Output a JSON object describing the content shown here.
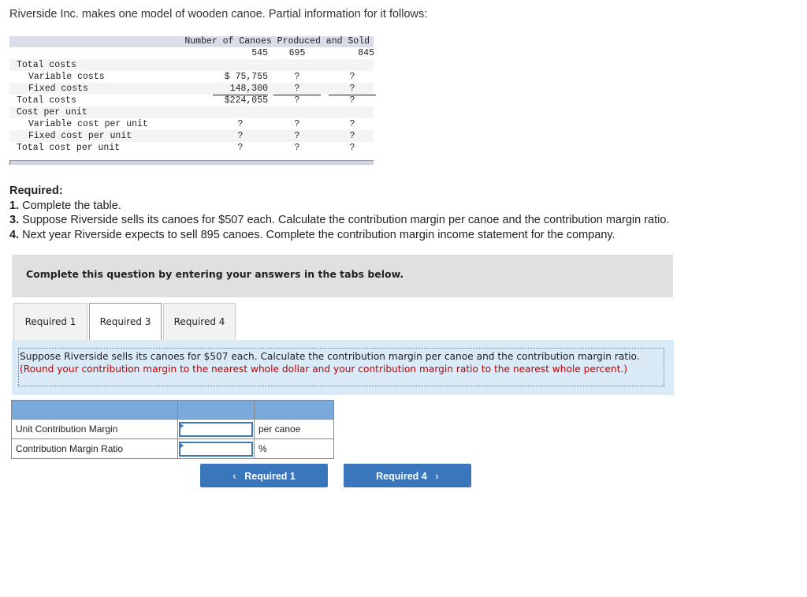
{
  "intro": "Riverside Inc. makes one model of wooden canoe. Partial information for it follows:",
  "cost_table": {
    "header": "Number of Canoes Produced and Sold",
    "columns": [
      "545",
      "695",
      "845"
    ],
    "rows": [
      {
        "label": "Total costs",
        "indent": false,
        "values": [
          "",
          "",
          ""
        ]
      },
      {
        "label": "Variable costs",
        "indent": true,
        "values": [
          "$ 75,755",
          "?",
          "?"
        ]
      },
      {
        "label": "Fixed costs",
        "indent": true,
        "values": [
          "148,300",
          "?",
          "?"
        ]
      },
      {
        "label": "Total costs",
        "indent": false,
        "values": [
          "$224,055",
          "?",
          "?"
        ]
      },
      {
        "label": "Cost per unit",
        "indent": false,
        "values": [
          "",
          "",
          ""
        ]
      },
      {
        "label": "Variable cost per unit",
        "indent": true,
        "values": [
          "?",
          "?",
          "?"
        ]
      },
      {
        "label": "Fixed cost per unit",
        "indent": true,
        "values": [
          "?",
          "?",
          "?"
        ]
      },
      {
        "label": "Total cost per unit",
        "indent": false,
        "values": [
          "?",
          "?",
          "?"
        ]
      }
    ]
  },
  "required": {
    "heading": "Required:",
    "items": [
      {
        "num": "1.",
        "text": " Complete the table."
      },
      {
        "num": "3.",
        "text": " Suppose Riverside sells its canoes for $507 each. Calculate the contribution margin per canoe and the contribution margin ratio."
      },
      {
        "num": "4.",
        "text": " Next year Riverside expects to sell 895 canoes. Complete the contribution margin income statement for the company."
      }
    ]
  },
  "banner": "Complete this question by entering your answers in the tabs below.",
  "tabs": [
    {
      "label": "Required 1",
      "active": false
    },
    {
      "label": "Required 3",
      "active": true
    },
    {
      "label": "Required 4",
      "active": false
    }
  ],
  "question": {
    "text": "Suppose Riverside sells its canoes for $507 each. Calculate the contribution margin per canoe and the contribution margin ratio.",
    "note": "(Round your contribution margin to the nearest whole dollar and your contribution margin ratio to the nearest whole percent.)"
  },
  "answer_table": {
    "rows": [
      {
        "label": "Unit Contribution Margin",
        "value": "",
        "unit": "per canoe"
      },
      {
        "label": "Contribution Margin Ratio",
        "value": "",
        "unit": "%"
      }
    ]
  },
  "nav": {
    "prev_label": "Required 1",
    "next_label": "Required 4",
    "prev_icon": "‹",
    "next_icon": "›"
  }
}
